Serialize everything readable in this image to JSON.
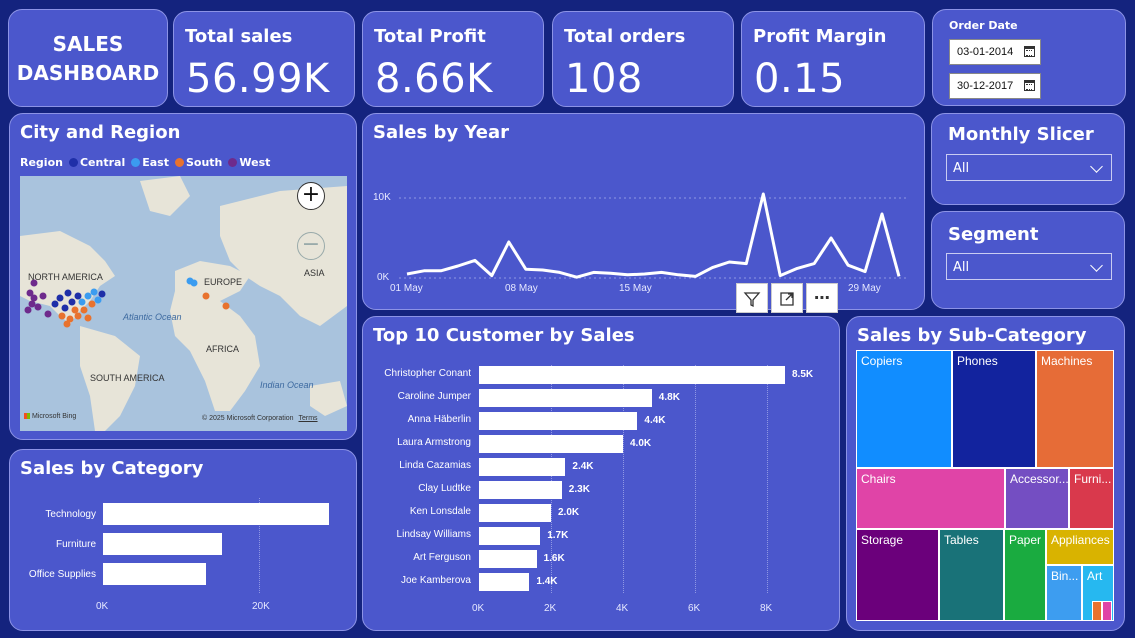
{
  "title": {
    "line1": "SALES",
    "line2": "DASHBOARD"
  },
  "kpis": [
    {
      "label": "Total sales",
      "value": "56.99K"
    },
    {
      "label": "Total Profit",
      "value": "8.66K"
    },
    {
      "label": "Total orders",
      "value": "108"
    },
    {
      "label": "Profit Margin",
      "value": "0.15"
    }
  ],
  "order_date": {
    "label": "Order Date",
    "start": "03-01-2014",
    "end": "30-12-2017"
  },
  "monthly_slicer": {
    "title": "Monthly Slicer",
    "value": "All"
  },
  "segment": {
    "title": "Segment",
    "value": "All"
  },
  "map": {
    "title": "City and Region",
    "legend_label": "Region",
    "regions": [
      {
        "name": "Central",
        "color": "#1f2fa8"
      },
      {
        "name": "East",
        "color": "#3b9cf0"
      },
      {
        "name": "South",
        "color": "#e8722e"
      },
      {
        "name": "West",
        "color": "#6e2a8c"
      }
    ],
    "labels": {
      "north_america": "NORTH AMERICA",
      "europe": "EUROPE",
      "asia": "ASIA",
      "africa": "AFRICA",
      "south_america": "SOUTH AMERICA",
      "atlantic": "Atlantic Ocean",
      "indian": "Indian Ocean",
      "bing": "Microsoft Bing",
      "copyright": "© 2025 Microsoft Corporation",
      "terms": "Terms"
    },
    "zoom_in": "+",
    "zoom_out": "−"
  },
  "sales_by_year": {
    "title": "Sales by Year",
    "y_ticks": [
      "10K",
      "0K"
    ],
    "x_ticks": [
      "01 May",
      "08 May",
      "15 May",
      "29 May"
    ],
    "series": [
      500,
      900,
      900,
      1500,
      2200,
      300,
      4500,
      1100,
      1000,
      700,
      100,
      700,
      600,
      400,
      500,
      700,
      400,
      200,
      1300,
      2000,
      1800,
      10500,
      300,
      1200,
      1800,
      5000,
      1600,
      800,
      8000,
      200
    ]
  },
  "toolbar": {
    "filter_icon": "filter-icon",
    "focus_icon": "expand-icon",
    "more": "⋯"
  },
  "top_customers": {
    "title": "Top 10 Customer by Sales",
    "x_ticks": [
      "0K",
      "2K",
      "4K",
      "6K",
      "8K"
    ],
    "items": [
      {
        "name": "Christopher Conant",
        "value": 8.5,
        "label": "8.5K"
      },
      {
        "name": "Caroline Jumper",
        "value": 4.8,
        "label": "4.8K"
      },
      {
        "name": "Anna Häberlin",
        "value": 4.4,
        "label": "4.4K"
      },
      {
        "name": "Laura Armstrong",
        "value": 4.0,
        "label": "4.0K"
      },
      {
        "name": "Linda Cazamias",
        "value": 2.4,
        "label": "2.4K"
      },
      {
        "name": "Clay Ludtke",
        "value": 2.3,
        "label": "2.3K"
      },
      {
        "name": "Ken Lonsdale",
        "value": 2.0,
        "label": "2.0K"
      },
      {
        "name": "Lindsay Williams",
        "value": 1.7,
        "label": "1.7K"
      },
      {
        "name": "Art Ferguson",
        "value": 1.6,
        "label": "1.6K"
      },
      {
        "name": "Joe Kamberova",
        "value": 1.4,
        "label": "1.4K"
      }
    ]
  },
  "sales_by_category": {
    "title": "Sales by Category",
    "x_ticks": [
      "0K",
      "20K"
    ],
    "items": [
      {
        "name": "Technology",
        "value": 29
      },
      {
        "name": "Furniture",
        "value": 15.2
      },
      {
        "name": "Office Supplies",
        "value": 13.2
      }
    ]
  },
  "sub_category": {
    "title": "Sales by Sub-Category",
    "cells": [
      {
        "name": "Copiers",
        "color": "#118dff"
      },
      {
        "name": "Phones",
        "color": "#12239e"
      },
      {
        "name": "Machines",
        "color": "#e66c37"
      },
      {
        "name": "Chairs",
        "color": "#e044a7"
      },
      {
        "name": "Accessor...",
        "color": "#744ec2"
      },
      {
        "name": "Furni...",
        "color": "#d9394c"
      },
      {
        "name": "Storage",
        "color": "#6b007b"
      },
      {
        "name": "Tables",
        "color": "#197278"
      },
      {
        "name": "Paper",
        "color": "#1aab40"
      },
      {
        "name": "Appliances",
        "color": "#d9b300"
      },
      {
        "name": "Bin...",
        "color": "#3d9df0"
      },
      {
        "name": "Art",
        "color": "#26b8f0"
      }
    ]
  },
  "chart_data": [
    {
      "type": "line",
      "title": "Sales by Year",
      "x_ticks": [
        "01 May",
        "08 May",
        "15 May",
        "29 May"
      ],
      "y_ticks": [
        "0K",
        "10K"
      ],
      "ylim": [
        0,
        11000
      ]
    },
    {
      "type": "bar",
      "title": "Top 10 Customer by Sales",
      "categories": [
        "Christopher Conant",
        "Caroline Jumper",
        "Anna Häberlin",
        "Laura Armstrong",
        "Linda Cazamias",
        "Clay Ludtke",
        "Ken Lonsdale",
        "Lindsay Williams",
        "Art Ferguson",
        "Joe Kamberova"
      ],
      "values": [
        8500,
        4800,
        4400,
        4000,
        2400,
        2300,
        2000,
        1700,
        1600,
        1400
      ],
      "xlim": [
        0,
        9000
      ]
    },
    {
      "type": "bar",
      "title": "Sales by Category",
      "categories": [
        "Technology",
        "Furniture",
        "Office Supplies"
      ],
      "values": [
        29000,
        15200,
        13200
      ],
      "xlim": [
        0,
        30000
      ]
    }
  ]
}
